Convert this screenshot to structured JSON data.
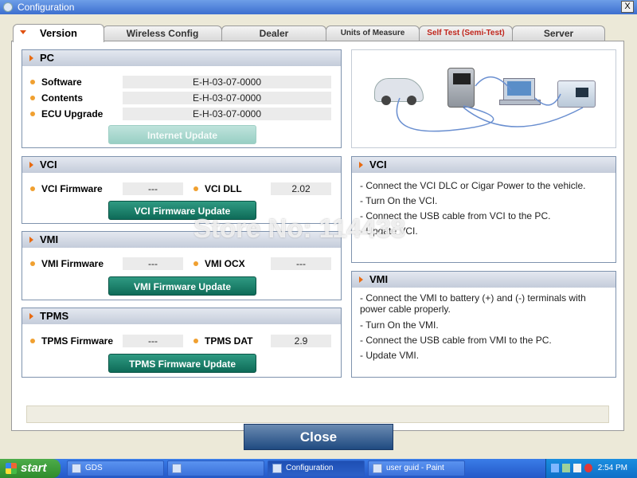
{
  "window": {
    "title": "Configuration",
    "close_glyph": "X"
  },
  "tabs": [
    {
      "label": "Version"
    },
    {
      "label": "Wireless Config"
    },
    {
      "label": "Dealer"
    },
    {
      "label": "Units of Measure"
    },
    {
      "label": "Self Test (Semi-Test)"
    },
    {
      "label": "Server"
    }
  ],
  "pc": {
    "title": "PC",
    "rows": [
      {
        "label": "Software",
        "value": "E-H-03-07-0000"
      },
      {
        "label": "Contents",
        "value": "E-H-03-07-0000"
      },
      {
        "label": "ECU Upgrade",
        "value": "E-H-03-07-0000"
      }
    ],
    "button": "Internet Update"
  },
  "vci": {
    "title": "VCI",
    "fw_label": "VCI Firmware",
    "fw_value": "---",
    "dll_label": "VCI DLL",
    "dll_value": "2.02",
    "button": "VCI Firmware Update"
  },
  "vmi": {
    "title": "VMI",
    "fw_label": "VMI Firmware",
    "fw_value": "---",
    "ocx_label": "VMI OCX",
    "ocx_value": "---",
    "button": "VMI Firmware Update"
  },
  "tpms": {
    "title": "TPMS",
    "fw_label": "TPMS Firmware",
    "fw_value": "---",
    "dat_label": "TPMS DAT",
    "dat_value": "2.9",
    "button": "TPMS Firmware Update"
  },
  "vci_info": {
    "title": "VCI",
    "lines": [
      "- Connect the VCI DLC or Cigar Power to the vehicle.",
      "- Turn On the VCI.",
      "- Connect the USB cable from VCI to the PC.",
      "- Update VCI."
    ]
  },
  "vmi_info": {
    "title": "VMI",
    "lines": [
      "- Connect the VMI to battery (+) and (-) terminals with power cable properly.",
      "- Turn On the VMI.",
      "- Connect the USB cable from VMI to the PC.",
      "- Update VMI."
    ]
  },
  "close_label": "Close",
  "watermark": "Store No: 114438",
  "taskbar": {
    "start": "start",
    "items": [
      {
        "label": "GDS",
        "icon": "app-icon"
      },
      {
        "label": "",
        "icon": "app-icon"
      },
      {
        "label": "Configuration",
        "icon": "app-icon"
      },
      {
        "label": "user guid - Paint",
        "icon": "paint-icon"
      }
    ],
    "clock": "2:54 PM"
  },
  "colors": {
    "accent_teal": "#0e6b58",
    "tab_red": "#c0251c",
    "bullet_orange": "#f0a030"
  }
}
